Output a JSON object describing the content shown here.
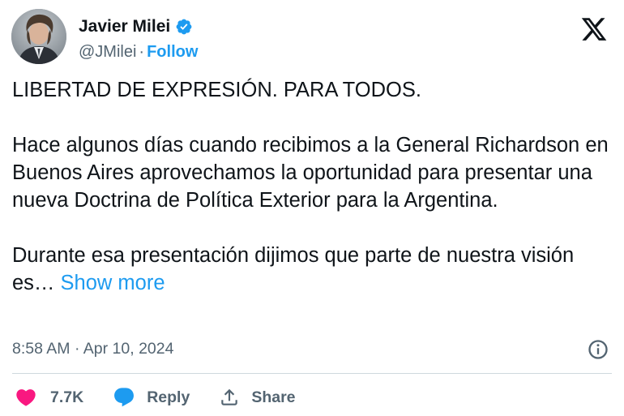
{
  "author": {
    "name": "Javier Milei",
    "handle": "@JMilei",
    "separator": "·",
    "follow_label": "Follow",
    "verified": true
  },
  "platform_icon": "x-logo-icon",
  "tweet": {
    "paragraphs": [
      "LIBERTAD DE EXPRESIÓN. PARA TODOS.",
      "Hace algunos días cuando recibimos a la General Richardson en Buenos Aires aprovechamos la oportunidad para presentar una nueva Doctrina de Política Exterior para la Argentina.",
      "Durante esa presentación dijimos que parte de nuestra visión es…"
    ],
    "show_more_label": "Show more",
    "timestamp": "8:58 AM · Apr 10, 2024"
  },
  "actions": {
    "like_count": "7.7K",
    "reply_label": "Reply",
    "share_label": "Share"
  },
  "colors": {
    "accent": "#1d9bf0",
    "like": "#f91880",
    "muted_text": "#536471",
    "text": "#0f1419"
  }
}
